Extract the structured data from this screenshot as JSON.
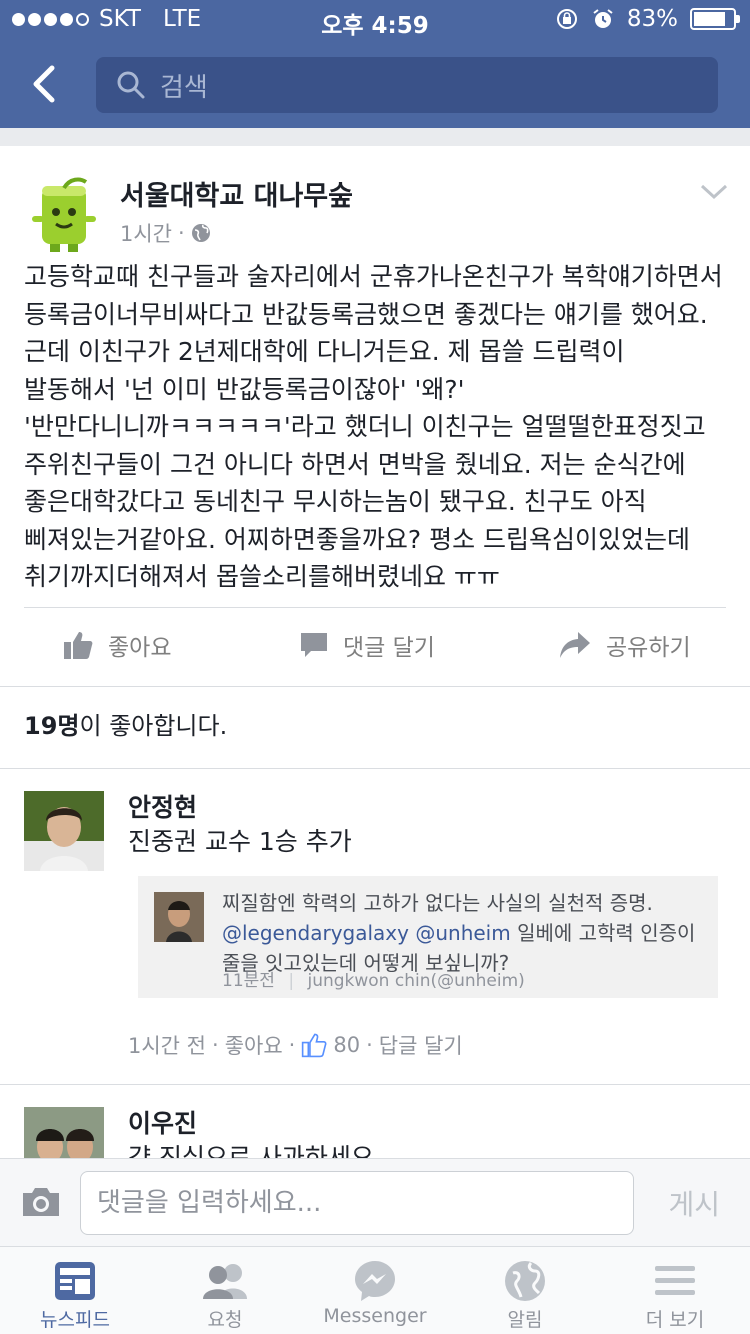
{
  "status": {
    "carrier": "SKT",
    "network": "LTE",
    "time": "오후 4:59",
    "battery": "83%",
    "battery_level": 0.83
  },
  "nav": {
    "search_placeholder": "검색"
  },
  "post": {
    "page_name": "서울대학교 대나무숲",
    "time": "1시간",
    "separator": "·",
    "text": "고등학교때 친구들과 술자리에서 군휴가나온친구가 복학얘기하면서 등록금이너무비싸다고 반값등록금했으면 좋겠다는 얘기를 했어요. 근데 이친구가 2년제대학에 다니거든요. 제 몹쓸 드립력이 발동해서 '넌 이미 반값등록금이잖아' '왜?' '반만다니니까ㅋㅋㅋㅋㅋ'라고 했더니 이친구는 얼떨떨한표정짓고 주위친구들이 그건 아니다 하면서 면박을 줬네요. 저는 순식간에 좋은대학갔다고 동네친구 무시하는놈이 됐구요. 친구도 아직 삐져있는거같아요. 어찌하면좋을까요? 평소 드립욕심이있었는데 취기까지더해져서 몹쓸소리를해버렸네요 ㅠㅠ",
    "actions": {
      "like": "좋아요",
      "comment": "댓글 달기",
      "share": "공유하기"
    },
    "likes_count": "19명",
    "likes_suffix": "이 좋아합니다."
  },
  "comments": [
    {
      "name": "안정현",
      "text": "진중권 교수 1승 추가",
      "embed": {
        "text_1": "찌질함엔 학력의 고하가 없다는 사실의 실천적 증명.",
        "handle_1": "@legendarygalaxy",
        "handle_2": "@unheim",
        "text_2": "일베에 고학력 인증이 줄을 잇고있는데 어떻게 보싶니까?",
        "time": "11분전",
        "author": "jungkwon chin(@unheim)"
      },
      "meta": {
        "time": "1시간 전",
        "dot": "·",
        "like": "좋아요",
        "like_count": "80",
        "reply": "답글 달기"
      }
    },
    {
      "name": "이우진",
      "text": "걍 진심으로 사과하세요"
    }
  ],
  "composer": {
    "placeholder": "댓글을 입력하세요...",
    "post_label": "게시"
  },
  "tabs": [
    {
      "label": "뉴스피드",
      "icon": "news-feed-icon",
      "active": true
    },
    {
      "label": "요청",
      "icon": "friend-requests-icon",
      "active": false
    },
    {
      "label": "Messenger",
      "icon": "messenger-icon",
      "active": false
    },
    {
      "label": "알림",
      "icon": "globe-icon",
      "active": false
    },
    {
      "label": "더 보기",
      "icon": "menu-icon",
      "active": false
    }
  ],
  "colors": {
    "brand": "#4b67a1",
    "link": "#3b5998",
    "muted": "#90949c"
  }
}
